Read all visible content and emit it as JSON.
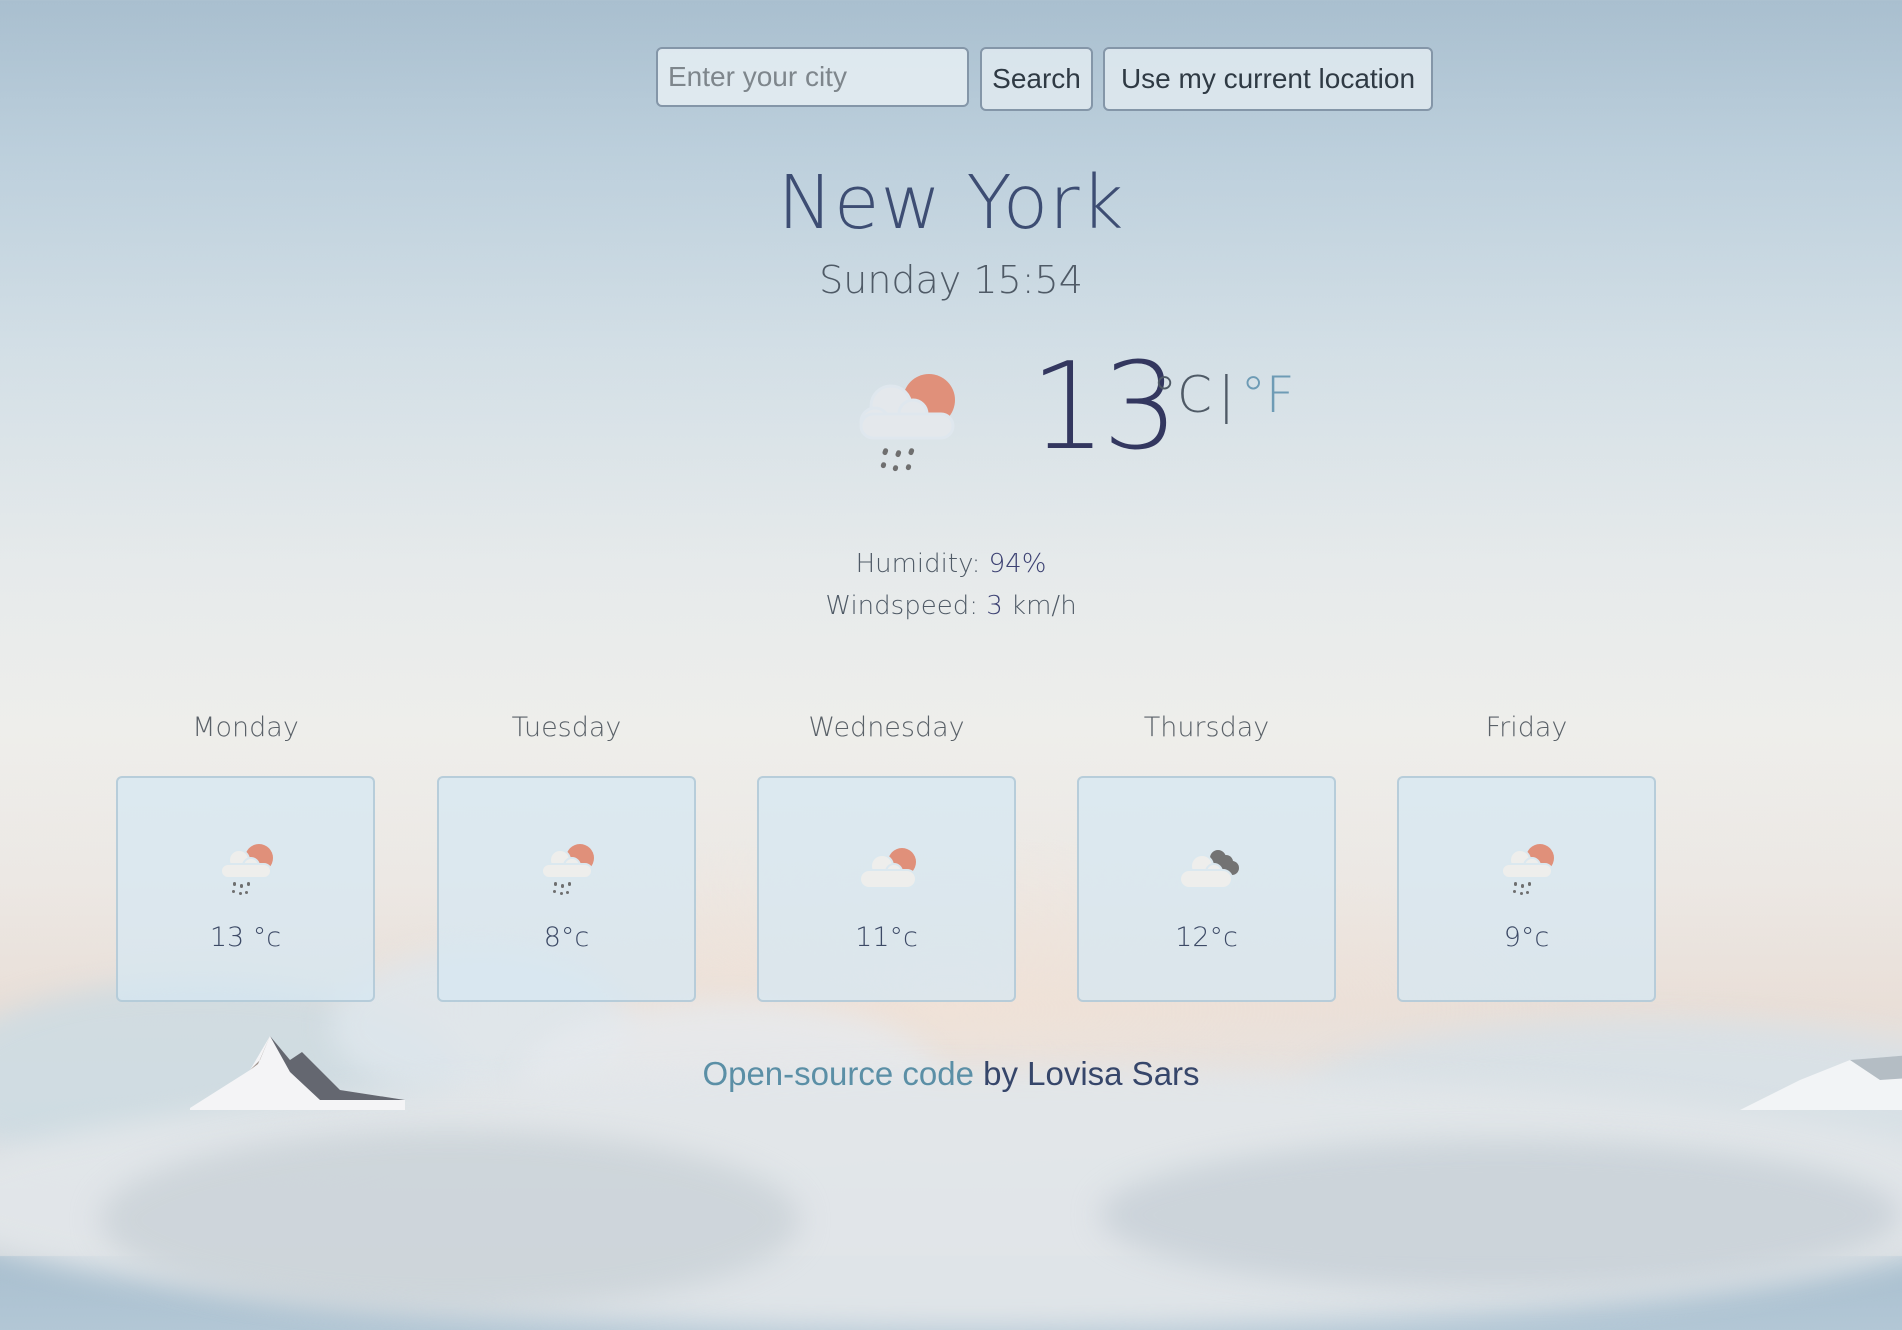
{
  "search": {
    "placeholder": "Enter your city",
    "value": "",
    "search_label": "Search",
    "location_label": "Use my current location"
  },
  "current": {
    "city": "New York",
    "datetime": "Sunday 15:54",
    "icon": "rain-cloud-sun-icon",
    "temperature": "13",
    "unit_celsius": "°C",
    "unit_separator": "|",
    "unit_fahrenheit": "°F",
    "humidity_label": "Humidity:",
    "humidity_value": "94%",
    "windspeed_label": "Windspeed:",
    "windspeed_value": "3",
    "windspeed_unit": "km/h"
  },
  "forecast": [
    {
      "day": "Monday",
      "icon": "rain-cloud-sun-icon",
      "temp": "13 °c"
    },
    {
      "day": "Tuesday",
      "icon": "rain-cloud-sun-icon",
      "temp": "8°c"
    },
    {
      "day": "Wednesday",
      "icon": "cloud-sun-icon",
      "temp": "11°c"
    },
    {
      "day": "Thursday",
      "icon": "dark-clouds-icon",
      "temp": "12°c"
    },
    {
      "day": "Friday",
      "icon": "rain-cloud-sun-icon",
      "temp": "9°c"
    }
  ],
  "footer": {
    "link_text": "Open-source code",
    "suffix": " by Lovisa Sars"
  },
  "colors": {
    "sun": "#e0907a",
    "cloud": "#eeeeec",
    "dark_cloud": "#737373",
    "rain": "#6f6f6f",
    "link": "#5b8fa6",
    "primary_text": "#3d4d73"
  }
}
